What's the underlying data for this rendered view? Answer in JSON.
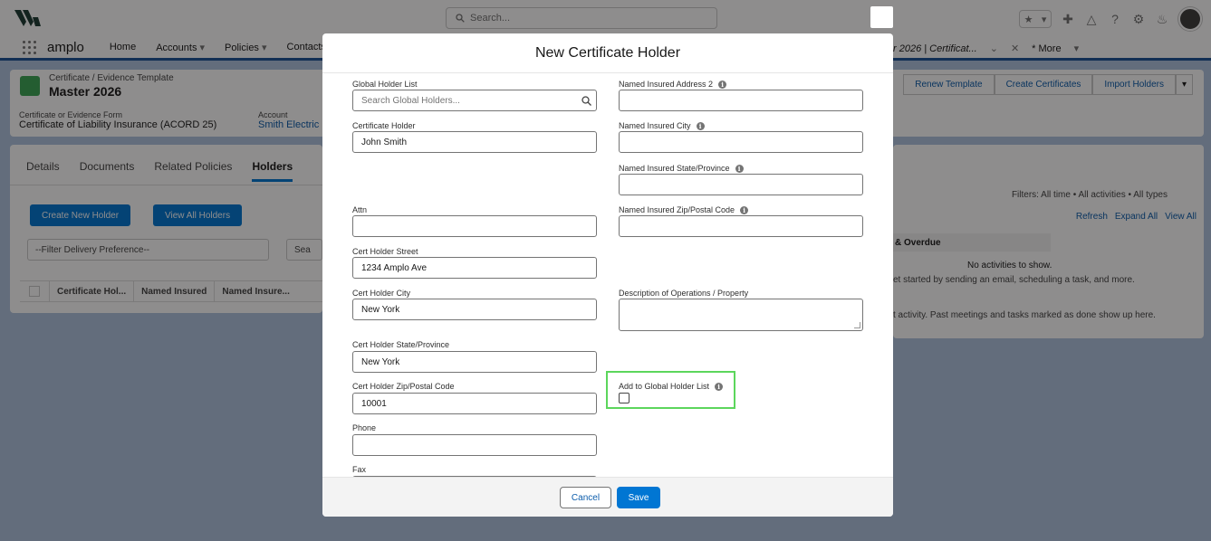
{
  "app": {
    "name": "amplo",
    "search_placeholder": "Search...",
    "nav_items": [
      "Home",
      "Accounts",
      "Policies",
      "Contacts"
    ],
    "open_tab": "r 2026 | Certificat...",
    "more": "* More"
  },
  "record": {
    "type": "Certificate / Evidence Template",
    "title": "Master 2026",
    "form_label": "Certificate or Evidence Form",
    "form_value": "Certificate of Liability Insurance (ACORD 25)",
    "account_label": "Account",
    "account_value": "Smith Electric",
    "actions": [
      "Renew Template",
      "Create Certificates",
      "Import Holders"
    ]
  },
  "left_card": {
    "tabs": [
      "Details",
      "Documents",
      "Related Policies",
      "Holders"
    ],
    "create_button": "Create New Holder",
    "view_all_button": "View All Holders",
    "filter_placeholder": "--Filter Delivery Preference--",
    "search_partial": "Sea",
    "columns": [
      "Certificate Hol...",
      "Named Insured",
      "Named Insure..."
    ]
  },
  "activity": {
    "filters": "Filters: All time • All activities • All types",
    "refresh": "Refresh",
    "expand_all": "Expand All",
    "view_all": "View All",
    "overdue": "& Overdue",
    "no_activities": "No activities to show.",
    "get_started": "et started by sending an email, scheduling a task, and more.",
    "past": "t activity. Past meetings and tasks marked as done show up here."
  },
  "modal": {
    "title": "New Certificate Holder",
    "fields": {
      "global_holder_list": {
        "label": "Global Holder List",
        "placeholder": "Search Global Holders..."
      },
      "certificate_holder": {
        "label": "Certificate Holder",
        "value": "John Smith"
      },
      "attn": {
        "label": "Attn",
        "value": ""
      },
      "cert_holder_street": {
        "label": "Cert Holder Street",
        "value": "1234 Amplo Ave"
      },
      "cert_holder_city": {
        "label": "Cert Holder City",
        "value": "New York"
      },
      "cert_holder_state": {
        "label": "Cert Holder State/Province",
        "value": "New York"
      },
      "cert_holder_zip": {
        "label": "Cert Holder Zip/Postal Code",
        "value": "10001"
      },
      "phone": {
        "label": "Phone",
        "value": ""
      },
      "fax": {
        "label": "Fax",
        "value": ""
      },
      "named_insured_address2": {
        "label": "Named Insured Address 2",
        "value": ""
      },
      "named_insured_city": {
        "label": "Named Insured City",
        "value": ""
      },
      "named_insured_state": {
        "label": "Named Insured State/Province",
        "value": ""
      },
      "named_insured_zip": {
        "label": "Named Insured Zip/Postal Code",
        "value": ""
      },
      "description": {
        "label": "Description of Operations / Property",
        "value": ""
      },
      "add_to_global": {
        "label": "Add to Global Holder List",
        "checked": false
      }
    },
    "cancel": "Cancel",
    "save": "Save"
  },
  "colors": {
    "brand_blue": "#0176d3",
    "highlight_green": "#5cd65c",
    "nav_border": "#1b5297"
  }
}
